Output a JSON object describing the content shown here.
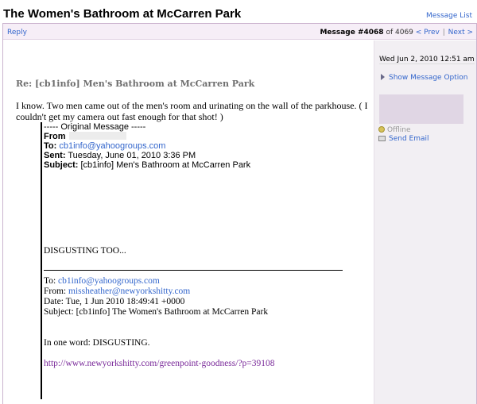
{
  "topic_title": "The Women's Bathroom at McCarren Park",
  "message_list_label": "Message List",
  "toolbar": {
    "reply_label": "Reply",
    "message_number": "Message #4068",
    "of_text": "of 4069",
    "prev_label": "< Prev",
    "separator": "|",
    "next_label": "Next >"
  },
  "message": {
    "subject": "Re: [cb1info] Men's Bathroom at McCarren Park",
    "body": "I know. Two men came out of the men's room and urinating on the wall of the parkhouse. ( I couldn't get my camera out fast enough for that shot! )",
    "quoted": {
      "header": "----- Original Message -----",
      "from_label": "From",
      "to_label": "To:",
      "to_value": "cb1info@yahoogroups.com",
      "sent_label": "Sent:",
      "sent_value": "Tuesday, June 01, 2010 3:36 PM",
      "subject_label": "Subject:",
      "subject_value": "[cb1info] Men's Bathroom at McCarren Park",
      "text1": "DISGUSTING TOO...",
      "to2_label": "To:",
      "to2_value": "cb1info@yahoogroups.com",
      "from2_label": "From:",
      "from2_value": "missheather@newyorkshitty.com",
      "date2": "Date: Tue, 1 Jun 2010 18:49:41 +0000",
      "subject2": "Subject: [cb1info] The Women's Bathroom at McCarren Park",
      "text2": "In one word: DISGUSTING.",
      "link": "http://www.newyorkshitty.com/greenpoint-goodness/?p=39108"
    }
  },
  "sidebar": {
    "date": "Wed Jun 2, 2010 12:51 am",
    "show_options_label": "Show Message Option",
    "status": "Offline",
    "send_email_label": "Send Email"
  },
  "colors": {
    "link": "#3366cc",
    "visited_link": "#7a2a9a",
    "sidebar_bg": "#f2eff3",
    "toolbar_bg": "#f6eef7",
    "frame_border": "#cbb4cf"
  }
}
